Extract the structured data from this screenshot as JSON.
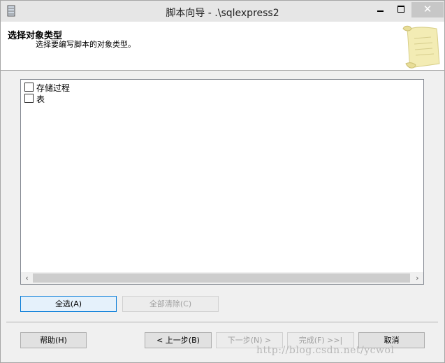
{
  "window": {
    "title": "脚本向导 - .\\sqlexpress2",
    "close_glyph": "✕"
  },
  "header": {
    "title": "选择对象类型",
    "subtitle": "选择要编写脚本的对象类型。"
  },
  "object_types": [
    {
      "label": "存储过程",
      "checked": false
    },
    {
      "label": "表",
      "checked": false
    }
  ],
  "scrollbar": {
    "left_arrow": "‹",
    "right_arrow": "›"
  },
  "selection_buttons": {
    "select_all": "全选(A)",
    "clear_all": "全部清除(C)"
  },
  "nav_buttons": {
    "help": "帮助(H)",
    "back": "< 上一步(B)",
    "next": "下一步(N) >",
    "finish": "完成(F) >>|",
    "cancel": "取消"
  },
  "watermark": "http://blog.csdn.net/ycwol",
  "colors": {
    "focus_border": "#0078d7",
    "window_bg": "#f0f0f0"
  }
}
